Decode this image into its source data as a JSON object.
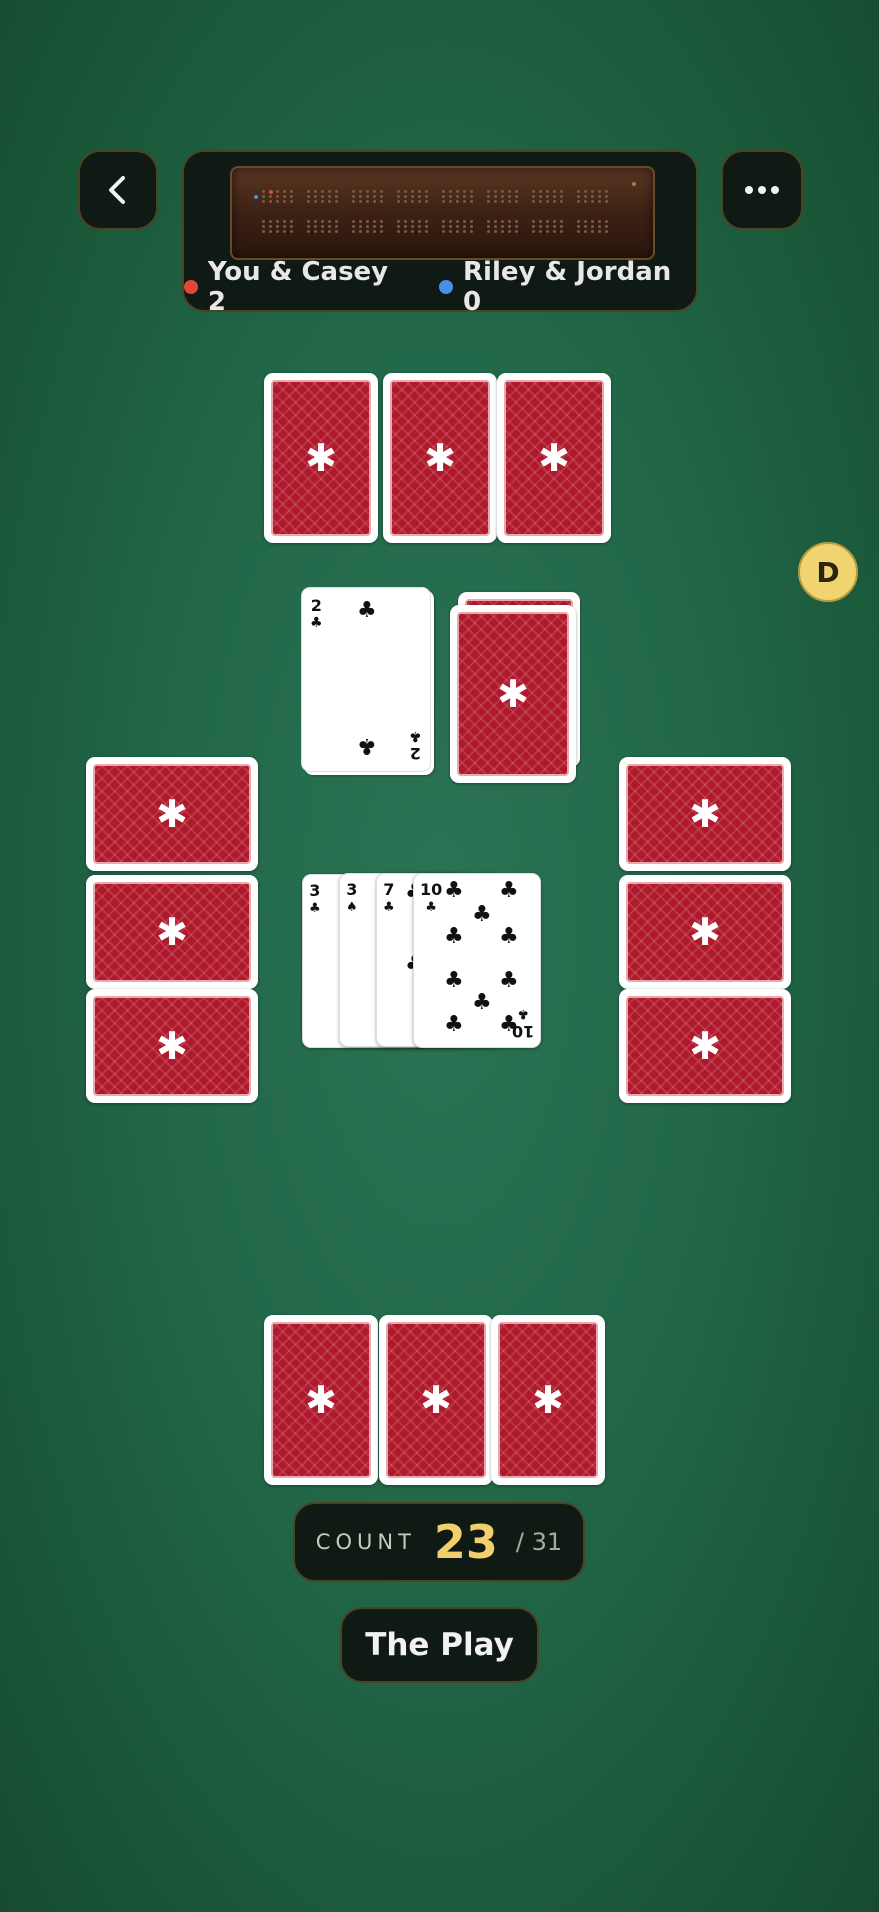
{
  "header": {
    "back_icon": "chevron-left-icon",
    "menu_icon": "more-horizontal-icon"
  },
  "scoreboard": {
    "teams": [
      {
        "name": "You & Casey",
        "score": "2",
        "label": "You & Casey 2",
        "color": "#e0463a"
      },
      {
        "name": "Riley & Jordan",
        "score": "0",
        "label": "Riley & Jordan 0",
        "color": "#4a90e6"
      }
    ]
  },
  "dealer_badge": "D",
  "starter_card": {
    "rank": "2",
    "suit": "♣"
  },
  "played_cards": [
    {
      "rank": "3",
      "suit": "♣"
    },
    {
      "rank": "3",
      "suit": "♠"
    },
    {
      "rank": "7",
      "suit": "♣"
    },
    {
      "rank": "10",
      "suit": "♣"
    }
  ],
  "count": {
    "label": "COUNT",
    "value": "23",
    "max": "/ 31"
  },
  "phase_label": "The Play",
  "colors": {
    "card_back": "#b0192b",
    "felt": "#216748",
    "count_gold": "#f2cf6a"
  }
}
